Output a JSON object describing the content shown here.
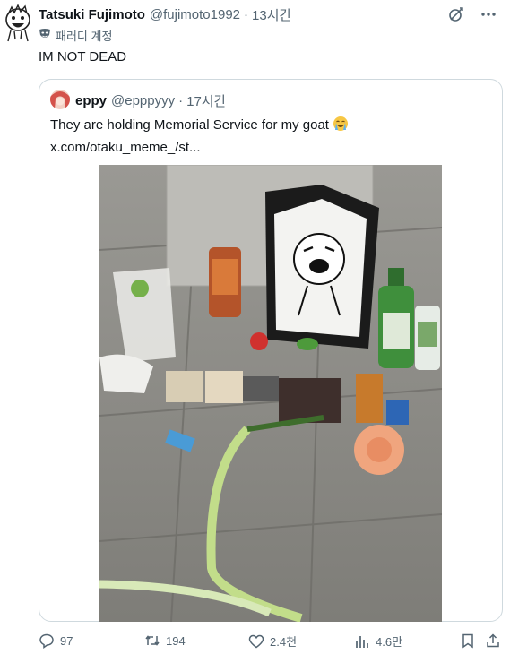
{
  "author": {
    "display_name": "Tatsuki Fujimoto",
    "handle": "@fujimoto1992",
    "separator": "·",
    "time": "13시간",
    "parody_label": "패러디 계정"
  },
  "tweet": {
    "text": "IM NOT DEAD"
  },
  "quote": {
    "display_name": "eppy",
    "handle": "@epppyyy",
    "separator": "·",
    "time": "17시간",
    "text": "They are holding Memorial Service for my goat",
    "link": "x.com/otaku_meme_/st..."
  },
  "actions": {
    "replies": "97",
    "reposts": "194",
    "likes": "2.4천",
    "views": "4.6만"
  },
  "colors": {
    "text_primary": "#0f1419",
    "text_secondary": "#536471",
    "border": "#cfd9de"
  },
  "icons": [
    "grok-icon",
    "more-icon",
    "parody-mask-icon",
    "crying-emoji-icon",
    "reply-icon",
    "repost-icon",
    "like-icon",
    "views-icon",
    "bookmark-icon",
    "share-icon"
  ]
}
